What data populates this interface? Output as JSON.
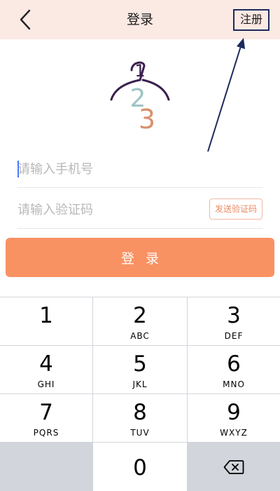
{
  "header": {
    "title": "登录",
    "back_icon": "chevron-left-icon",
    "register_label": "注册"
  },
  "logo": {
    "digit_1": "1",
    "digit_2": "2",
    "digit_3": "3",
    "colors": {
      "hanger": "#3b1f4e",
      "digit_2": "#9fc3c5",
      "digit_3": "#d9906a"
    }
  },
  "form": {
    "phone_placeholder": "请输入手机号",
    "code_placeholder": "请输入验证码",
    "send_code_label": "发送验证码",
    "login_label": "登录"
  },
  "keypad": {
    "keys": [
      {
        "number": "1",
        "letters": ""
      },
      {
        "number": "2",
        "letters": "ABC"
      },
      {
        "number": "3",
        "letters": "DEF"
      },
      {
        "number": "4",
        "letters": "GHI"
      },
      {
        "number": "5",
        "letters": "JKL"
      },
      {
        "number": "6",
        "letters": "MNO"
      },
      {
        "number": "7",
        "letters": "PQRS"
      },
      {
        "number": "8",
        "letters": "TUV"
      },
      {
        "number": "9",
        "letters": "WXYZ"
      },
      {
        "number": "0",
        "letters": ""
      }
    ],
    "backspace_icon": "backspace-icon"
  },
  "colors": {
    "header_bg": "#fbe9e3",
    "accent": "#f99263",
    "send_code_text": "#e98a63",
    "annotation": "#1c2a5c",
    "keypad_bg": "#d2d5db"
  }
}
